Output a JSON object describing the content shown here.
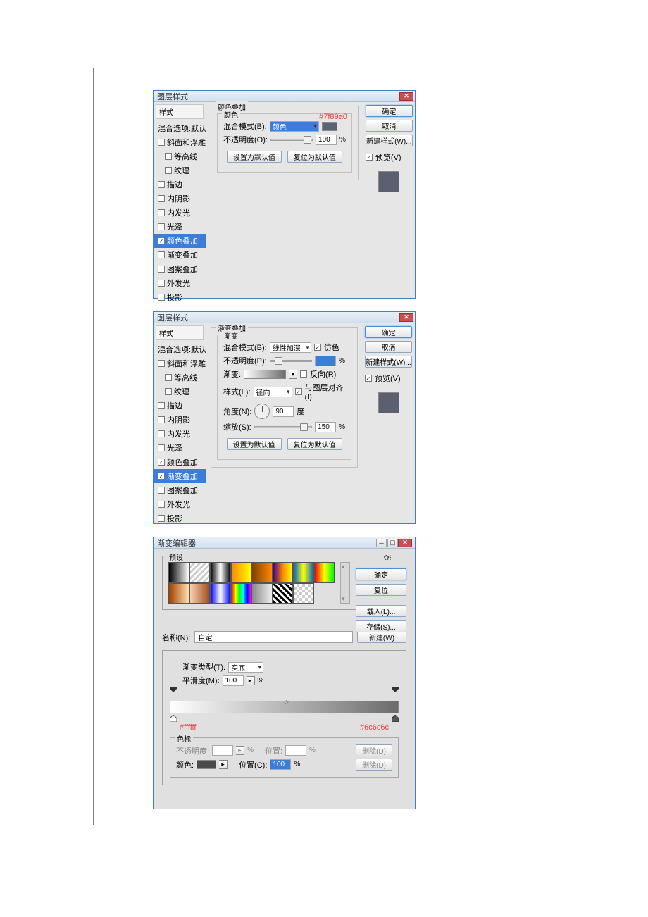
{
  "dlg1": {
    "title": "图层样式",
    "group_title": "颜色叠加",
    "inner_title": "颜色",
    "annot": "#7f89a0",
    "blend_label": "混合模式(B):",
    "blend_value": "颜色",
    "opacity_label": "不透明度(O):",
    "opacity_value": "100",
    "pct": "%",
    "btn_default": "设置为默认值",
    "btn_reset": "复位为默认值",
    "styles_header": "样式",
    "styles": [
      "混合选项:默认",
      "斜面和浮雕",
      "等高线",
      "纹理",
      "描边",
      "内阴影",
      "内发光",
      "光泽",
      "颜色叠加",
      "渐变叠加",
      "图案叠加",
      "外发光",
      "投影"
    ],
    "ok": "确定",
    "cancel": "取消",
    "newstyle": "新建样式(W)...",
    "preview": "预览(V)"
  },
  "dlg2": {
    "title": "图层样式",
    "group_title": "渐变叠加",
    "inner_title": "渐变",
    "blend_label": "混合模式(B):",
    "blend_value": "线性加深",
    "dither": "仿色",
    "opacity_label": "不透明度(P):",
    "pct": "%",
    "grad_label": "渐变:",
    "reverse": "反向(R)",
    "style_label": "样式(L):",
    "style_value": "径向",
    "align": "与图层对齐(I)",
    "angle_label": "角度(N):",
    "angle_value": "90",
    "angle_unit": "度",
    "scale_label": "缩放(S):",
    "scale_value": "150",
    "btn_default": "设置为默认值",
    "btn_reset": "复位为默认值",
    "styles_header": "样式",
    "styles": [
      "混合选项:默认",
      "斜面和浮雕",
      "等高线",
      "纹理",
      "描边",
      "内阴影",
      "内发光",
      "光泽",
      "颜色叠加",
      "渐变叠加",
      "图案叠加",
      "外发光",
      "投影"
    ],
    "ok": "确定",
    "cancel": "取消",
    "newstyle": "新建样式(W)...",
    "preview": "预览(V)"
  },
  "ge": {
    "title": "渐变编辑器",
    "presets": "预设",
    "ok": "确定",
    "reset": "复位",
    "load": "载入(L)...",
    "save": "存储(S)...",
    "name_label": "名称(N):",
    "name_value": "自定",
    "new": "新建(W)",
    "type_label": "渐变类型(T):",
    "type_value": "实底",
    "smooth_label": "平滑度(M):",
    "smooth_value": "100",
    "pct": "%",
    "annot_l": "#ffffff",
    "annot_r": "#6c6c6c",
    "stops_legend": "色标",
    "op_label": "不透明度:",
    "pos_label": "位置:",
    "color_label": "颜色:",
    "posc_label": "位置(C):",
    "posc_value": "100",
    "delete": "删除(D)"
  }
}
